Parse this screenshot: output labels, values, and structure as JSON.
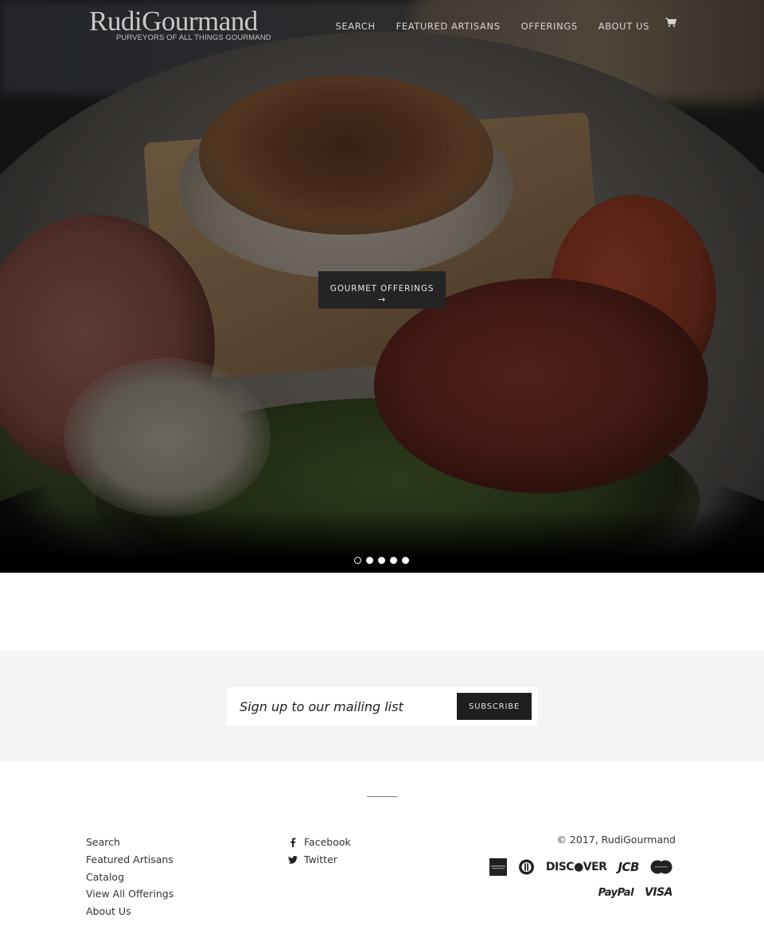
{
  "header": {
    "logo_title": "RudiGourmand",
    "logo_tagline": "PURVEYORS OF ALL THINGS GOURMAND",
    "nav": [
      {
        "label": "Search"
      },
      {
        "label": "Featured Artisans"
      },
      {
        "label": "Offerings"
      },
      {
        "label": "About Us"
      }
    ],
    "cart_icon": "cart-icon"
  },
  "hero": {
    "cta_label": "GOURMET OFFERINGS",
    "cta_arrow": "→",
    "slides_count": 5,
    "active_slide": 1
  },
  "newsletter": {
    "placeholder": "Sign up to our mailing list",
    "value": "",
    "subscribe_label": "SUBSCRIBE"
  },
  "footer": {
    "links": [
      {
        "label": "Search"
      },
      {
        "label": "Featured Artisans"
      },
      {
        "label": "Catalog"
      },
      {
        "label": "View All Offerings"
      },
      {
        "label": "About Us"
      }
    ],
    "social": [
      {
        "label": "Facebook",
        "icon": "facebook-icon"
      },
      {
        "label": "Twitter",
        "icon": "twitter-icon"
      }
    ],
    "copyright": "© 2017, RudiGourmand",
    "payment_methods": [
      "American Express",
      "Diners Club",
      "Discover",
      "JCB",
      "MasterCard",
      "PayPal",
      "Visa"
    ],
    "payment_labels": {
      "discover": "DISC●VER",
      "jcb": "JCB",
      "paypal": "PayPal",
      "visa": "VISA"
    }
  },
  "colors": {
    "button_dark": "#1f1f1f",
    "newsletter_bg": "#f4f4f4",
    "nav_text": "#d5d5d5"
  }
}
